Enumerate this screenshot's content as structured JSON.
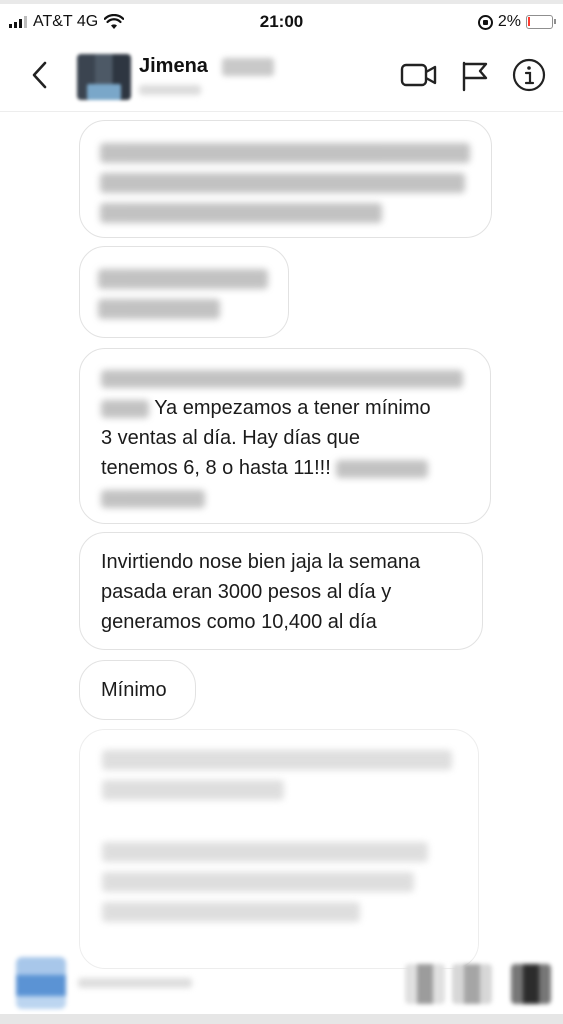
{
  "status_bar": {
    "carrier": "AT&T 4G",
    "time": "21:00",
    "battery_percent": "2%",
    "battery_level": 0.02
  },
  "header": {
    "contact_name": "Jimena",
    "icons": [
      "back-chevron-icon",
      "video-call-icon",
      "flag-icon",
      "info-icon"
    ]
  },
  "messages": [
    {
      "id": "msg-3",
      "text_visible": "Ya empezamos a tener mínimo 3 ventas al día. Hay días que tenemos 6, 8 o hasta 11!!!"
    },
    {
      "id": "msg-4",
      "text": "Invirtiendo nose bien jaja la semana pasada eran 3000 pesos al día y generamos como 10,400 al día"
    },
    {
      "id": "msg-5",
      "text": "Mínimo"
    }
  ],
  "msg3_lines": {
    "line2": "Ya empezamos a tener mínimo",
    "line3": "3 ventas al día. Hay días que",
    "line4": "tenemos 6, 8 o hasta 11!!!"
  },
  "msg4_lines": {
    "line1": "Invirtiendo nose bien jaja la semana",
    "line2": "pasada eran 3000 pesos al día y",
    "line3": "generamos como 10,400 al día"
  },
  "msg5_text": "Mínimo",
  "colors": {
    "bubble_border": "#e2e2e2",
    "text": "#1b1b1b",
    "battery_low": "#ff3b30"
  }
}
